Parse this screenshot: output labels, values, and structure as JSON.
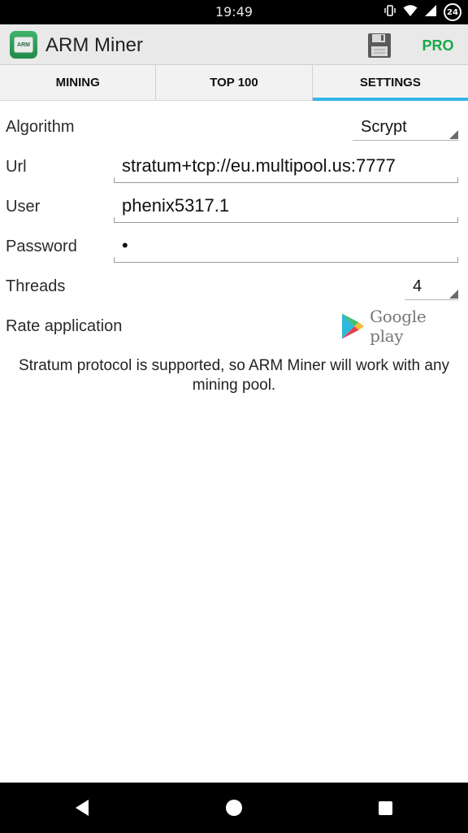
{
  "status": {
    "time": "19:49",
    "battery_level": "24",
    "icons": [
      "vibrate-icon",
      "wifi-icon",
      "signal-icon",
      "battery-icon"
    ]
  },
  "app": {
    "title": "ARM Miner",
    "icon_label": "ARM",
    "pro_label": "PRO",
    "save_icon": "save-icon"
  },
  "tabs": [
    {
      "label": "MINING",
      "active": false
    },
    {
      "label": "TOP 100",
      "active": false
    },
    {
      "label": "SETTINGS",
      "active": true
    }
  ],
  "form": {
    "algorithm": {
      "label": "Algorithm",
      "value": "Scrypt"
    },
    "url": {
      "label": "Url",
      "value": "stratum+tcp://eu.multipool.us:7777"
    },
    "user": {
      "label": "User",
      "value": "phenix5317.1"
    },
    "password": {
      "label": "Password",
      "value": "•"
    },
    "threads": {
      "label": "Threads",
      "value": "4"
    },
    "rate": {
      "label": "Rate application",
      "store_text": "Google play"
    }
  },
  "info_text": "Stratum protocol is supported, so ARM Miner will work with any mining pool.",
  "colors": {
    "accent": "#33b5e5",
    "pro": "#1aa84a",
    "actionbar": "#e9e9e9"
  }
}
